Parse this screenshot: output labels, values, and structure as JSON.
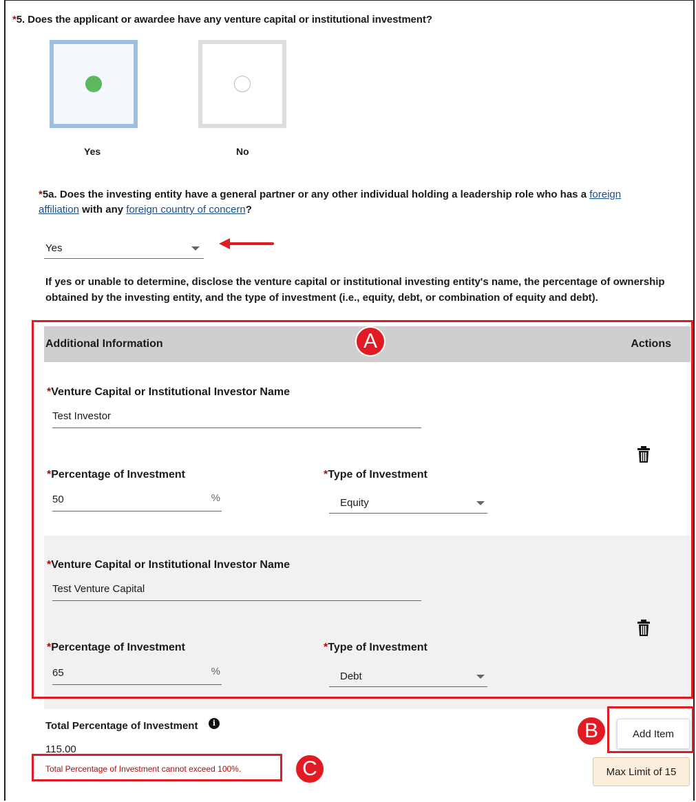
{
  "question5": {
    "required_marker": "*",
    "text": "5. Does the applicant or awardee have any venture capital or institutional investment?",
    "options": [
      {
        "label": "Yes",
        "selected": true
      },
      {
        "label": "No",
        "selected": false
      }
    ]
  },
  "question5a": {
    "required_marker": "*",
    "prefix": "5a. Does the investing entity have a general partner or any other individual holding a leadership role who has a ",
    "link1": "foreign affiliation",
    "middle": " with any ",
    "link2": "foreign country of concern",
    "suffix": "?",
    "selected_value": "Yes"
  },
  "disclosure_text": "If yes or unable to determine, disclose the venture capital or institutional investing entity's name, the percentage of ownership obtained by the investing entity, and the type of investment (i.e., equity, debt, or combination of equity and debt).",
  "section": {
    "header_title": "Additional Information",
    "header_actions": "Actions",
    "items": [
      {
        "name_label": "Venture Capital or Institutional Investor Name",
        "name_value": "Test Investor",
        "pct_label": "Percentage of Investment",
        "pct_value": "50",
        "pct_unit": "%",
        "type_label": "Type of Investment",
        "type_value": "Equity"
      },
      {
        "name_label": "Venture Capital or Institutional Investor Name",
        "name_value": "Test Venture Capital",
        "pct_label": "Percentage of Investment",
        "pct_value": "65",
        "pct_unit": "%",
        "type_label": "Type of Investment",
        "type_value": "Debt"
      }
    ]
  },
  "total": {
    "label": "Total Percentage of Investment",
    "info_icon": "info-icon",
    "value": "115.00",
    "error": "Total Percentage of Investment cannot exceed 100%."
  },
  "add_item_label": "Add Item",
  "max_limit_label": "Max Limit of 15",
  "callouts": {
    "a": "A",
    "b": "B",
    "c": "C"
  },
  "colors": {
    "required": "#b50909",
    "callout": "#e01b24",
    "radio_selected": "#5cb85c",
    "link": "#1a4e8a"
  }
}
